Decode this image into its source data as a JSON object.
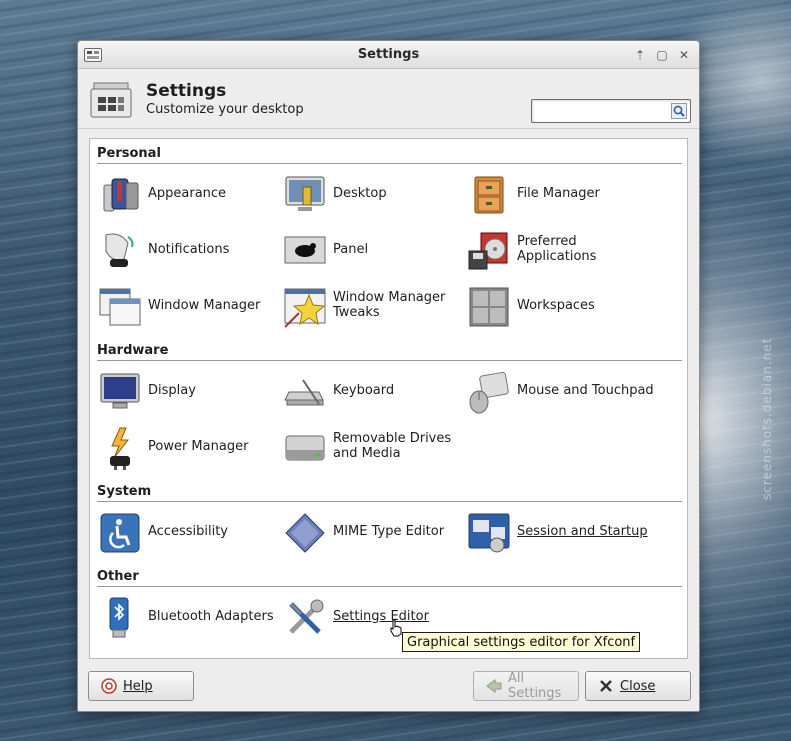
{
  "watermark": "screenshots.debian.net",
  "window": {
    "title": "Settings",
    "controls": {
      "up": "⇡",
      "maximize": "▢",
      "close": "✕"
    }
  },
  "header": {
    "title": "Settings",
    "subtitle": "Customize your desktop",
    "search_value": ""
  },
  "categories": {
    "personal": "Personal",
    "hardware": "Hardware",
    "system": "System",
    "other": "Other"
  },
  "items": {
    "appearance": "Appearance",
    "desktop": "Desktop",
    "file_manager": "File Manager",
    "notifications": "Notifications",
    "panel": "Panel",
    "preferred_applications": "Preferred Applications",
    "window_manager": "Window Manager",
    "window_manager_tweaks": "Window Manager Tweaks",
    "workspaces": "Workspaces",
    "display": "Display",
    "keyboard": "Keyboard",
    "mouse_touchpad": "Mouse and Touchpad",
    "power_manager": "Power Manager",
    "removable_drives": "Removable Drives and Media",
    "accessibility": "Accessibility",
    "mime_editor": "MIME Type Editor",
    "session_startup": "Session and Startup",
    "bluetooth": "Bluetooth Adapters",
    "settings_editor": "Settings Editor"
  },
  "tooltip": "Graphical settings editor for Xfconf",
  "buttons": {
    "help": "Help",
    "all_settings": "All Settings",
    "close": "Close"
  },
  "colors": {
    "accent_blue": "#2f5fa8",
    "tooltip_bg": "#fbfbd6"
  }
}
